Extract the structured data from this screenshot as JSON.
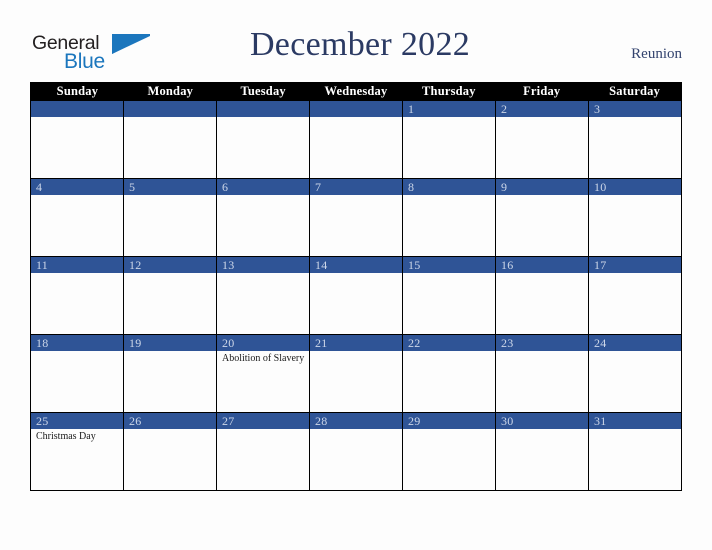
{
  "brand": {
    "name_part1": "General",
    "name_part2": "Blue",
    "triangle_icon": "triangle-icon",
    "accent_blue": "#1b76bd",
    "dark": "#231f20"
  },
  "header": {
    "title": "December 2022",
    "region": "Reunion",
    "title_color": "#2b3a63"
  },
  "colors": {
    "header_band": "#000000",
    "day_band": "#2f5496",
    "day_number_text": "#ccd6e8",
    "cell_background": "#fdfdfd",
    "page_background": "#fdfdfd",
    "grid_line": "#000000"
  },
  "calendar": {
    "month": "December",
    "year": "2022",
    "weekday_headers": [
      "Sunday",
      "Monday",
      "Tuesday",
      "Wednesday",
      "Thursday",
      "Friday",
      "Saturday"
    ],
    "weeks": [
      [
        {
          "day": "",
          "events": []
        },
        {
          "day": "",
          "events": []
        },
        {
          "day": "",
          "events": []
        },
        {
          "day": "",
          "events": []
        },
        {
          "day": "1",
          "events": []
        },
        {
          "day": "2",
          "events": []
        },
        {
          "day": "3",
          "events": []
        }
      ],
      [
        {
          "day": "4",
          "events": []
        },
        {
          "day": "5",
          "events": []
        },
        {
          "day": "6",
          "events": []
        },
        {
          "day": "7",
          "events": []
        },
        {
          "day": "8",
          "events": []
        },
        {
          "day": "9",
          "events": []
        },
        {
          "day": "10",
          "events": []
        }
      ],
      [
        {
          "day": "11",
          "events": []
        },
        {
          "day": "12",
          "events": []
        },
        {
          "day": "13",
          "events": []
        },
        {
          "day": "14",
          "events": []
        },
        {
          "day": "15",
          "events": []
        },
        {
          "day": "16",
          "events": []
        },
        {
          "day": "17",
          "events": []
        }
      ],
      [
        {
          "day": "18",
          "events": []
        },
        {
          "day": "19",
          "events": []
        },
        {
          "day": "20",
          "events": [
            "Abolition of Slavery"
          ]
        },
        {
          "day": "21",
          "events": []
        },
        {
          "day": "22",
          "events": []
        },
        {
          "day": "23",
          "events": []
        },
        {
          "day": "24",
          "events": []
        }
      ],
      [
        {
          "day": "25",
          "events": [
            "Christmas Day"
          ]
        },
        {
          "day": "26",
          "events": []
        },
        {
          "day": "27",
          "events": []
        },
        {
          "day": "28",
          "events": []
        },
        {
          "day": "29",
          "events": []
        },
        {
          "day": "30",
          "events": []
        },
        {
          "day": "31",
          "events": []
        }
      ]
    ]
  }
}
